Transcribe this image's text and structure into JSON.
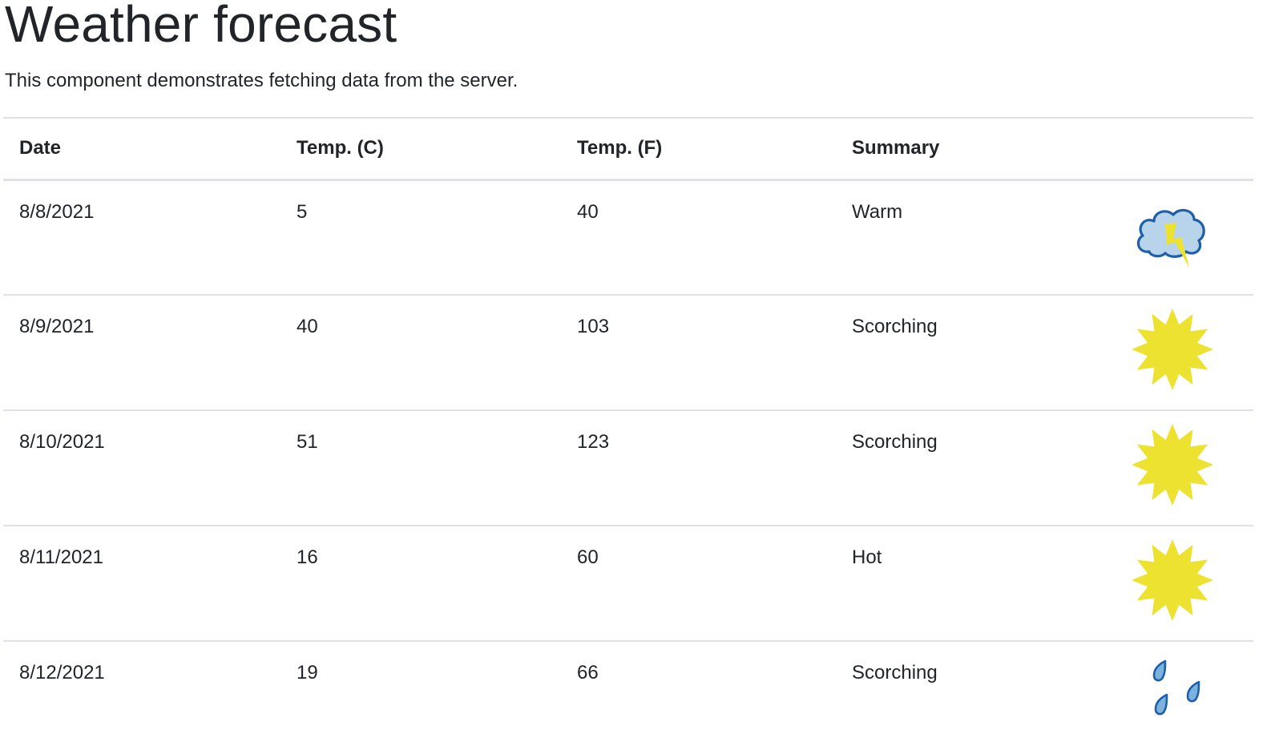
{
  "page": {
    "title": "Weather forecast",
    "subtitle": "This component demonstrates fetching data from the server."
  },
  "table": {
    "headers": {
      "date": "Date",
      "temp_c": "Temp. (C)",
      "temp_f": "Temp. (F)",
      "summary": "Summary"
    },
    "rows": [
      {
        "date": "8/8/2021",
        "temp_c": "5",
        "temp_f": "40",
        "summary": "Warm",
        "icon": "thunderstorm-icon"
      },
      {
        "date": "8/9/2021",
        "temp_c": "40",
        "temp_f": "103",
        "summary": "Scorching",
        "icon": "sun-icon"
      },
      {
        "date": "8/10/2021",
        "temp_c": "51",
        "temp_f": "123",
        "summary": "Scorching",
        "icon": "sun-icon"
      },
      {
        "date": "8/11/2021",
        "temp_c": "16",
        "temp_f": "60",
        "summary": "Hot",
        "icon": "sun-icon"
      },
      {
        "date": "8/12/2021",
        "temp_c": "19",
        "temp_f": "66",
        "summary": "Scorching",
        "icon": "rain-icon"
      }
    ]
  },
  "colors": {
    "text": "#212529",
    "border": "#dee2e6",
    "sun": "#ede22f",
    "cloud_fill": "#b8d4ea",
    "cloud_stroke": "#1f5ea8",
    "bolt": "#ede22f",
    "rain_fill": "#7ab3de",
    "rain_stroke": "#1f5ea8"
  }
}
